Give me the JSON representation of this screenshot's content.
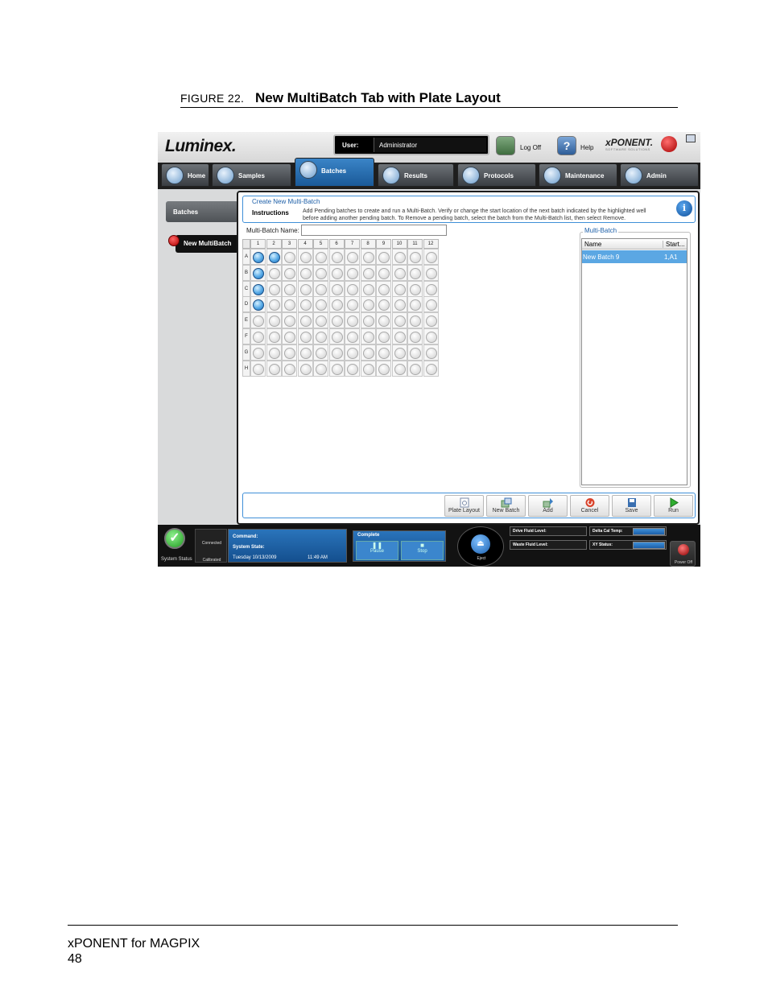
{
  "figure": {
    "number": "FIGURE 22.",
    "title": "New MultiBatch Tab with Plate Layout"
  },
  "footer": {
    "product": "xPONENT for MAGPIX",
    "page": "48"
  },
  "app": {
    "logo": "Luminex.",
    "user_label": "User:",
    "user_value": "Administrator",
    "logoff_label": "Log Off",
    "help_label": "Help",
    "brand": "xPONENT.",
    "brand_sub": "SOFTWARE SOLUTIONS"
  },
  "tabs": [
    {
      "label": "Home",
      "active": false
    },
    {
      "label": "Samples",
      "active": false
    },
    {
      "label": "Batches",
      "active": true
    },
    {
      "label": "Results",
      "active": false
    },
    {
      "label": "Protocols",
      "active": false
    },
    {
      "label": "Maintenance",
      "active": false
    },
    {
      "label": "Admin",
      "active": false
    }
  ],
  "sidebar": {
    "batches": "Batches",
    "new_multibatch": "New MultiBatch"
  },
  "panel": {
    "title": "Create New Multi-Batch",
    "instructions_label": "Instructions",
    "instructions_text": "Add Pending batches to create and run a Multi-Batch. Verify or change the start location of the next batch indicated by the highlighted well before adding another pending batch. To Remove a pending batch, select the batch from the Multi-Batch list, then select Remove.",
    "name_label": "Multi-Batch Name:",
    "name_value": ""
  },
  "plate": {
    "columns": [
      "1",
      "2",
      "3",
      "4",
      "5",
      "6",
      "7",
      "8",
      "9",
      "10",
      "11",
      "12"
    ],
    "rows": [
      "A",
      "B",
      "C",
      "D",
      "E",
      "F",
      "G",
      "H"
    ],
    "filled_wells": [
      "A1",
      "A2",
      "B1",
      "C1",
      "D1"
    ]
  },
  "multibatch": {
    "title": "Multi-Batch",
    "headers": [
      "Name",
      "Start..."
    ],
    "rows": [
      {
        "name": "New Batch 9",
        "start": "1,A1"
      }
    ]
  },
  "actions": [
    {
      "label": "Plate Layout",
      "icon": "plate-layout-icon",
      "color": "#7a8aa8"
    },
    {
      "label": "New Batch",
      "icon": "new-batch-icon",
      "color": "#4d8a4d"
    },
    {
      "label": "Add",
      "icon": "add-icon",
      "color": "#3c7fc2"
    },
    {
      "label": "Cancel",
      "icon": "cancel-icon",
      "color": "#d9432b"
    },
    {
      "label": "Save",
      "icon": "save-icon",
      "color": "#3a6fb0"
    },
    {
      "label": "Run",
      "icon": "run-icon",
      "color": "#2fae2f"
    }
  ],
  "status": {
    "system_status": "System Status",
    "connected": "Connected",
    "calibrated": "Calibrated",
    "command_label": "Command:",
    "state_label": "System State:",
    "date": "Tuesday 10/13/2009",
    "time": "11:49 AM",
    "complete": "Complete",
    "pause": "Pause",
    "stop": "Stop",
    "eject": "Eject",
    "drive_fluid": "Drive Fluid Level:",
    "waste_fluid": "Waste Fluid Level:",
    "delta_cal": "Delta Cal Temp:",
    "xy_status": "XY Status:",
    "power_off": "Power Off"
  }
}
